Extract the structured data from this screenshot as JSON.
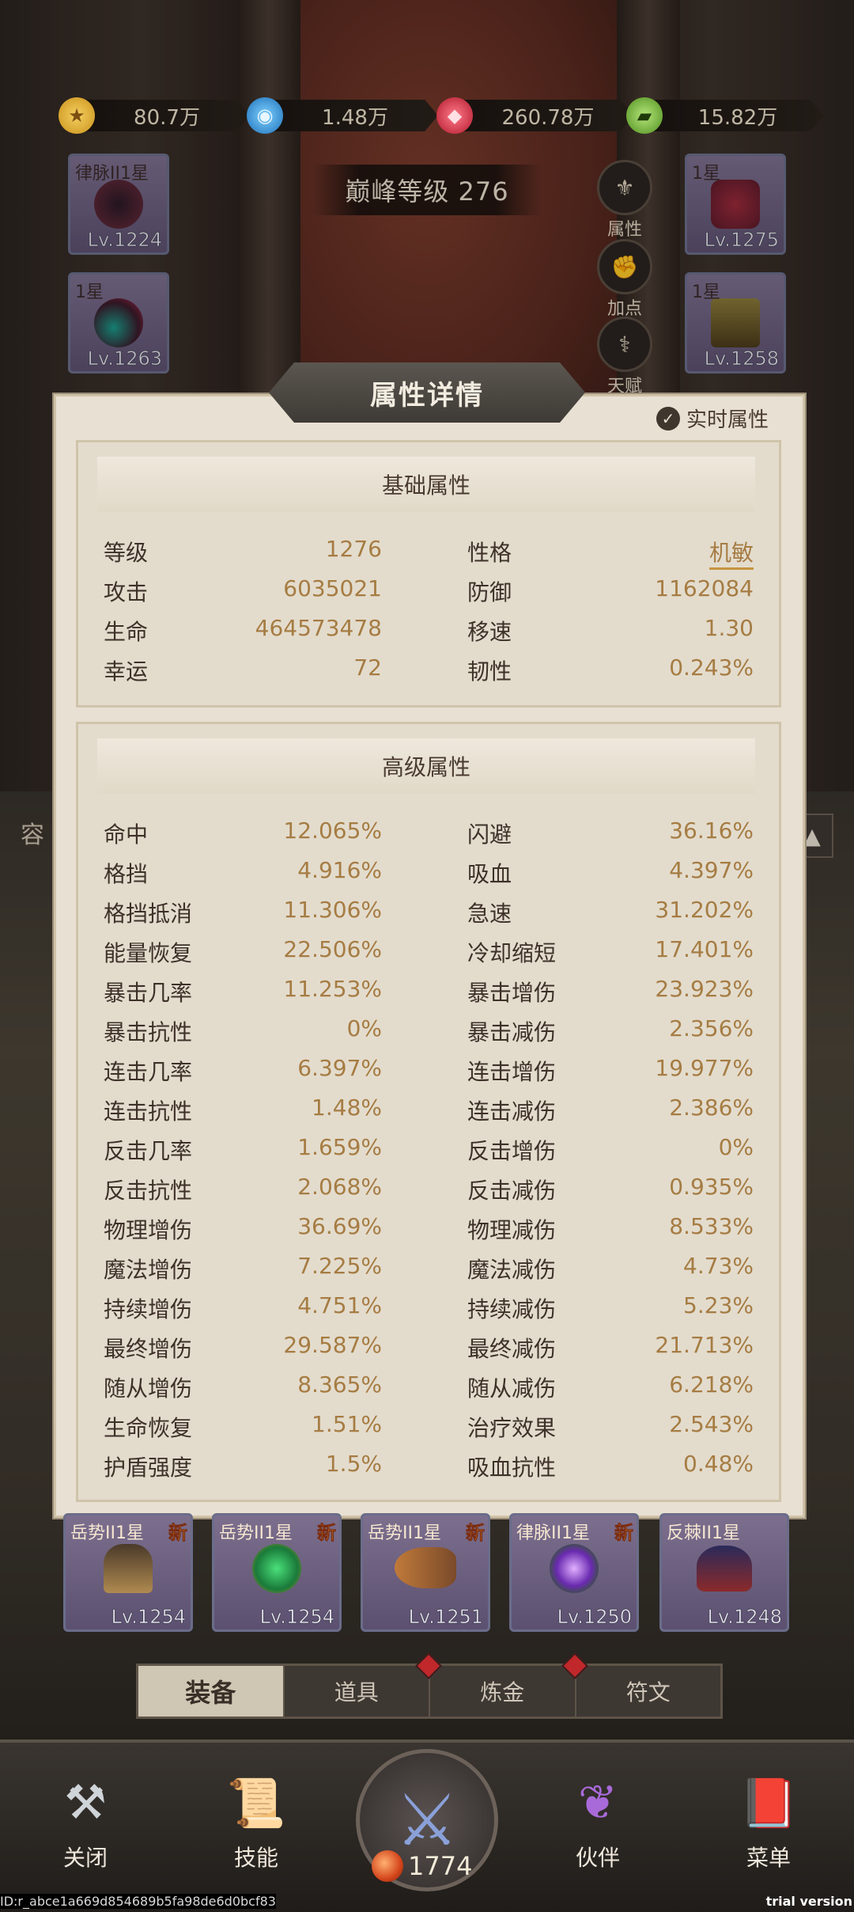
{
  "resources": [
    {
      "icon": "gold-coin-icon",
      "value": "80.7万",
      "color": "#e0a925"
    },
    {
      "icon": "blue-orb-icon",
      "value": "1.48万",
      "color": "#2a8ad8"
    },
    {
      "icon": "red-gem-icon",
      "value": "260.78万",
      "color": "#d2303d"
    },
    {
      "icon": "green-cash-icon",
      "value": "15.82万",
      "color": "#6fb33a"
    }
  ],
  "peak_level": "巅峰等级 276",
  "top_slots": [
    {
      "star": "律脉II1星",
      "level": "Lv.1224"
    },
    {
      "star": "1星",
      "level": "Lv.1263"
    },
    {
      "star": "1星",
      "level": "Lv.1275"
    },
    {
      "star": "1星",
      "level": "Lv.1258"
    }
  ],
  "side_buttons": [
    "属性",
    "加点",
    "天赋"
  ],
  "panel": {
    "title": "属性详情",
    "realtime_label": "实时属性",
    "basic_title": "基础属性",
    "basic": [
      {
        "k1": "等级",
        "v1": "1276",
        "k2": "性格",
        "v2": "机敏"
      },
      {
        "k1": "攻击",
        "v1": "6035021",
        "k2": "防御",
        "v2": "1162084"
      },
      {
        "k1": "生命",
        "v1": "464573478",
        "k2": "移速",
        "v2": "1.30"
      },
      {
        "k1": "幸运",
        "v1": "72",
        "k2": "韧性",
        "v2": "0.243%"
      }
    ],
    "advanced_title": "高级属性",
    "advanced": [
      {
        "k1": "命中",
        "v1": "12.065%",
        "k2": "闪避",
        "v2": "36.16%"
      },
      {
        "k1": "格挡",
        "v1": "4.916%",
        "k2": "吸血",
        "v2": "4.397%"
      },
      {
        "k1": "格挡抵消",
        "v1": "11.306%",
        "k2": "急速",
        "v2": "31.202%"
      },
      {
        "k1": "能量恢复",
        "v1": "22.506%",
        "k2": "冷却缩短",
        "v2": "17.401%"
      },
      {
        "k1": "暴击几率",
        "v1": "11.253%",
        "k2": "暴击增伤",
        "v2": "23.923%"
      },
      {
        "k1": "暴击抗性",
        "v1": "0%",
        "k2": "暴击减伤",
        "v2": "2.356%"
      },
      {
        "k1": "连击几率",
        "v1": "6.397%",
        "k2": "连击增伤",
        "v2": "19.977%"
      },
      {
        "k1": "连击抗性",
        "v1": "1.48%",
        "k2": "连击减伤",
        "v2": "2.386%"
      },
      {
        "k1": "反击几率",
        "v1": "1.659%",
        "k2": "反击增伤",
        "v2": "0%"
      },
      {
        "k1": "反击抗性",
        "v1": "2.068%",
        "k2": "反击减伤",
        "v2": "0.935%"
      },
      {
        "k1": "物理增伤",
        "v1": "36.69%",
        "k2": "物理减伤",
        "v2": "8.533%"
      },
      {
        "k1": "魔法增伤",
        "v1": "7.225%",
        "k2": "魔法减伤",
        "v2": "4.73%"
      },
      {
        "k1": "持续增伤",
        "v1": "4.751%",
        "k2": "持续减伤",
        "v2": "5.23%"
      },
      {
        "k1": "最终增伤",
        "v1": "29.587%",
        "k2": "最终减伤",
        "v2": "21.713%"
      },
      {
        "k1": "随从增伤",
        "v1": "8.365%",
        "k2": "随从减伤",
        "v2": "6.218%"
      },
      {
        "k1": "生命恢复",
        "v1": "1.51%",
        "k2": "治疗效果",
        "v2": "2.543%"
      },
      {
        "k1": "护盾强度",
        "v1": "1.5%",
        "k2": "吸血抗性",
        "v2": "0.48%"
      }
    ]
  },
  "bottom_items": [
    {
      "star": "岳势II1星",
      "level": "Lv.1254",
      "new": "新"
    },
    {
      "star": "岳势II1星",
      "level": "Lv.1254",
      "new": "新"
    },
    {
      "star": "岳势II1星",
      "level": "Lv.1251",
      "new": "新"
    },
    {
      "star": "律脉II1星",
      "level": "Lv.1250",
      "new": "新"
    },
    {
      "star": "反棘II1星",
      "level": "Lv.1248",
      "new": ""
    }
  ],
  "side_label": "容",
  "side_arrow": "▲",
  "tabs": [
    "装备",
    "道具",
    "炼金",
    "符文"
  ],
  "nav": [
    "关闭",
    "技能",
    "伙伴",
    "菜单"
  ],
  "player_level": "1774",
  "footer_id": "ID:r_abce1a669d854689b5fa98de6d0bcf83",
  "footer_trial": "trial version"
}
